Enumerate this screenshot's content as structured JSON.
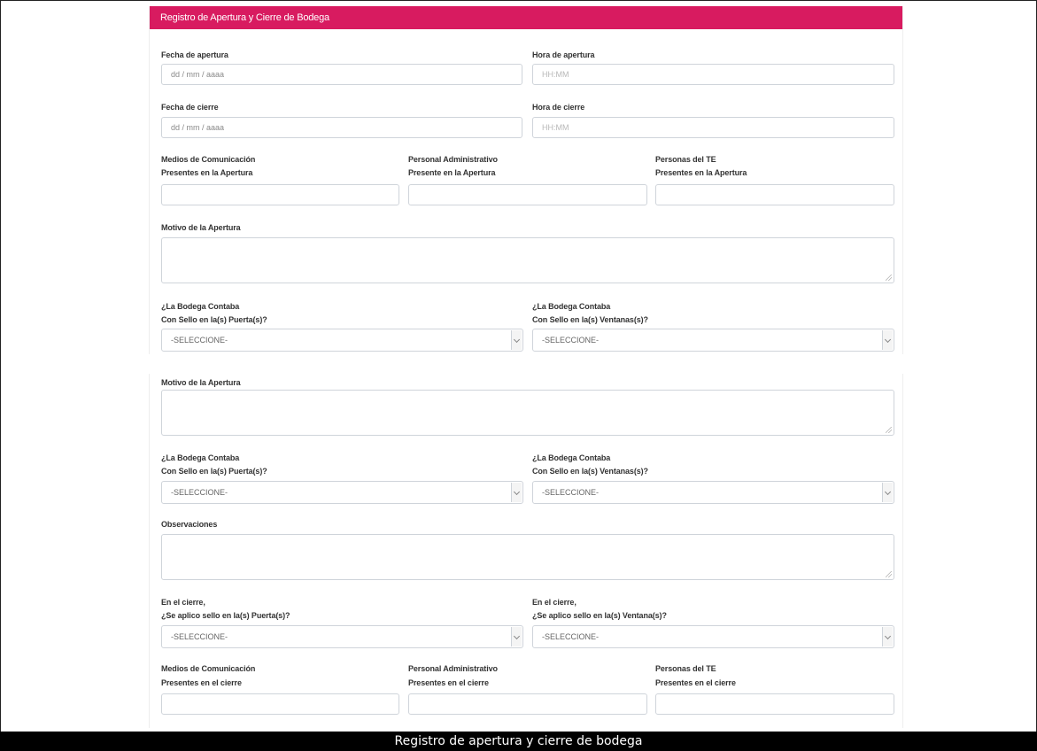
{
  "form": {
    "title": "Registro de Apertura y Cierre de Bodega",
    "fecha_apertura": {
      "label": "Fecha de apertura",
      "placeholder": "dd / mm / aaaa"
    },
    "hora_apertura": {
      "label": "Hora de apertura",
      "placeholder": "HH:MM"
    },
    "fecha_cierre": {
      "label": "Fecha de cierre",
      "placeholder": "dd / mm / aaaa"
    },
    "hora_cierre": {
      "label": "Hora de cierre",
      "placeholder": "HH:MM"
    },
    "medios_apertura": {
      "line1": "Medios de Comunicación",
      "line2": "Presentes en la Apertura"
    },
    "personal_apertura": {
      "line1": "Personal Administrativo",
      "line2": "Presente en la Apertura"
    },
    "personas_te_apertura": {
      "line1": "Personas del TE",
      "line2": "Presentes en la Apertura"
    },
    "motivo_label": "Motivo de la Apertura",
    "sello_puertas": {
      "line1": "¿La Bodega Contaba",
      "line2": "Con Sello en la(s) Puerta(s)?",
      "value": "-SELECCIONE-"
    },
    "sello_ventanas": {
      "line1": "¿La Bodega Contaba",
      "line2": "Con Sello en la(s) Ventanas(s)?",
      "value": "-SELECCIONE-"
    }
  },
  "form2": {
    "motivo_label": "Motivo de la Apertura",
    "sello_puertas": {
      "line1": "¿La Bodega Contaba",
      "line2": "Con Sello en la(s) Puerta(s)?",
      "value": "-SELECCIONE-"
    },
    "sello_ventanas": {
      "line1": "¿La Bodega Contaba",
      "line2": "Con Sello en la(s) Ventanas(s)?",
      "value": "-SELECCIONE-"
    },
    "observaciones_label": "Observaciones",
    "cierre_puertas": {
      "line1": "En el cierre,",
      "line2": "¿Se aplico sello en la(s) Puerta(s)?",
      "value": "-SELECCIONE-"
    },
    "cierre_ventanas": {
      "line1": "En el cierre,",
      "line2": "¿Se aplico sello en la(s) Ventana(s)?",
      "value": "-SELECCIONE-"
    },
    "medios_cierre": {
      "line1": "Medios de Comunicación",
      "line2": "Presentes en el cierre"
    },
    "personal_cierre": {
      "line1": "Personal Administrativo",
      "line2": "Presentes en el cierre"
    },
    "personas_te_cierre": {
      "line1": "Personas del TE",
      "line2": "Presentes en el cierre"
    }
  },
  "caption": "Registro de apertura y cierre de bodega",
  "colors": {
    "header": "#d81b60",
    "caption_bg": "#000000",
    "border": "#cfd4da"
  }
}
